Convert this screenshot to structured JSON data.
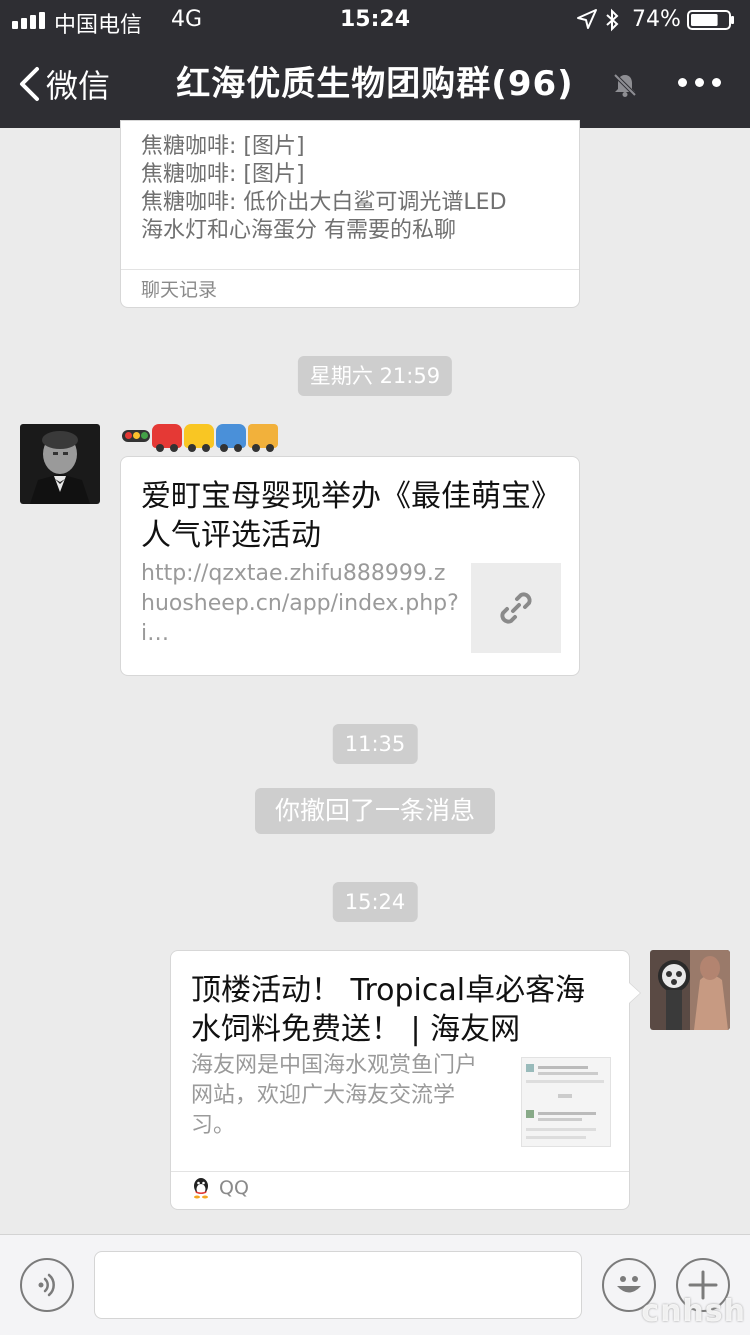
{
  "status_bar": {
    "carrier": "中国电信",
    "network": "4G",
    "time": "15:24",
    "battery_percent": "74%",
    "battery_level": 0.74
  },
  "nav": {
    "back_label": "微信",
    "title": "红海优质生物团购群(96)"
  },
  "chat_history_card": {
    "lines": [
      "焦糖咖啡: [图片]",
      "焦糖咖啡: [图片]",
      "焦糖咖啡: 低价出大白鲨可调光谱LED",
      "海水灯和心海蛋分 有需要的私聊"
    ],
    "footer": "聊天记录"
  },
  "timestamps": {
    "t1": "星期六 21:59",
    "t2": "11:35",
    "t3": "15:24"
  },
  "message_1": {
    "sender_name_emoji": "🚥🚗🚕🚙🚌",
    "title": "爱町宝母婴现举办《最佳萌宝》人气评选活动",
    "url": "http://qzxtae.zhifu888999.zhuosheep.cn/app/index.php?i…",
    "thumbnail_icon": "link-icon"
  },
  "recall_notice": "你撤回了一条消息",
  "message_2": {
    "title": "顶楼活动！ Tropical卓必客海水饲料免费送！ | 海友网",
    "description": "海友网是中国海水观赏鱼门户网站，欢迎广大海友交流学习。",
    "source": "QQ",
    "source_icon": "qq-penguin-icon"
  },
  "input_bar": {
    "placeholder": "",
    "voice_icon": "voice-icon",
    "emoji_icon": "emoji-icon",
    "plus_icon": "plus-icon"
  },
  "watermark": "cnhsh",
  "colors": {
    "nav_bg": "#2e2e33",
    "chat_bg": "#ebebeb",
    "timestamp_bg": "#cecece"
  }
}
